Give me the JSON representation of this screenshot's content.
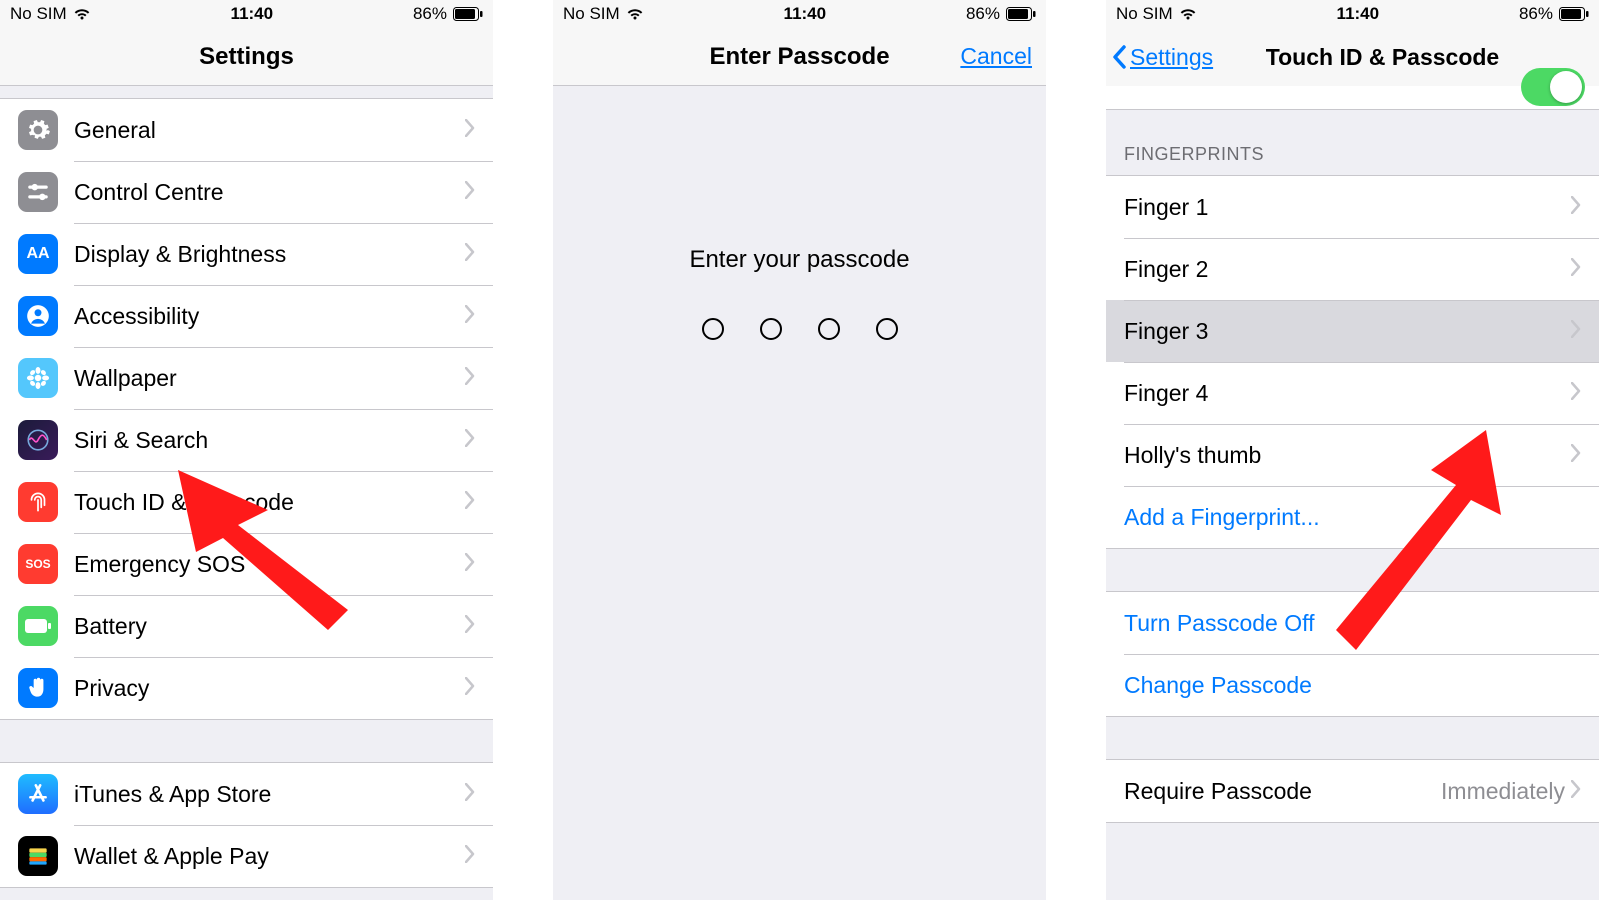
{
  "status": {
    "carrier": "No SIM",
    "time": "11:40",
    "battery_pct": "86%"
  },
  "screen1": {
    "title": "Settings",
    "groups": [
      [
        {
          "key": "general",
          "label": "General",
          "icon": "gear",
          "color": "ic-gray"
        },
        {
          "key": "control",
          "label": "Control Centre",
          "icon": "sliders",
          "color": "ic-gray2"
        },
        {
          "key": "display",
          "label": "Display & Brightness",
          "icon": "AA",
          "color": "ic-blue",
          "text_icon": "AA"
        },
        {
          "key": "accessibility",
          "label": "Accessibility",
          "icon": "person",
          "color": "ic-blue"
        },
        {
          "key": "wallpaper",
          "label": "Wallpaper",
          "icon": "flower",
          "color": "ic-cyan"
        },
        {
          "key": "siri",
          "label": "Siri & Search",
          "icon": "siri",
          "color": "ic-siri"
        },
        {
          "key": "touchid",
          "label": "Touch ID & Passcode",
          "icon": "fingerprint",
          "color": "ic-red"
        },
        {
          "key": "sos",
          "label": "Emergency SOS",
          "icon": "sos",
          "color": "ic-sos",
          "text_icon": "SOS"
        },
        {
          "key": "battery",
          "label": "Battery",
          "icon": "battery",
          "color": "ic-green"
        },
        {
          "key": "privacy",
          "label": "Privacy",
          "icon": "hand",
          "color": "ic-hand"
        }
      ],
      [
        {
          "key": "itunes",
          "label": "iTunes & App Store",
          "icon": "appstore",
          "color": "ic-appstore"
        },
        {
          "key": "wallet",
          "label": "Wallet & Apple Pay",
          "icon": "wallet",
          "color": "ic-wallet"
        }
      ]
    ]
  },
  "screen2": {
    "title": "Enter Passcode",
    "cancel_label": "Cancel",
    "prompt": "Enter your passcode",
    "digits": 4
  },
  "screen3": {
    "back_label": "Settings",
    "title": "Touch ID & Passcode",
    "fingerprints_header": "FINGERPRINTS",
    "fingerprints": [
      "Finger 1",
      "Finger 2",
      "Finger 3",
      "Finger 4",
      "Holly's thumb"
    ],
    "selected_fingerprint_index": 2,
    "add_label": "Add a Fingerprint...",
    "turn_off_label": "Turn Passcode Off",
    "change_label": "Change Passcode",
    "require_label": "Require Passcode",
    "require_value": "Immediately"
  }
}
